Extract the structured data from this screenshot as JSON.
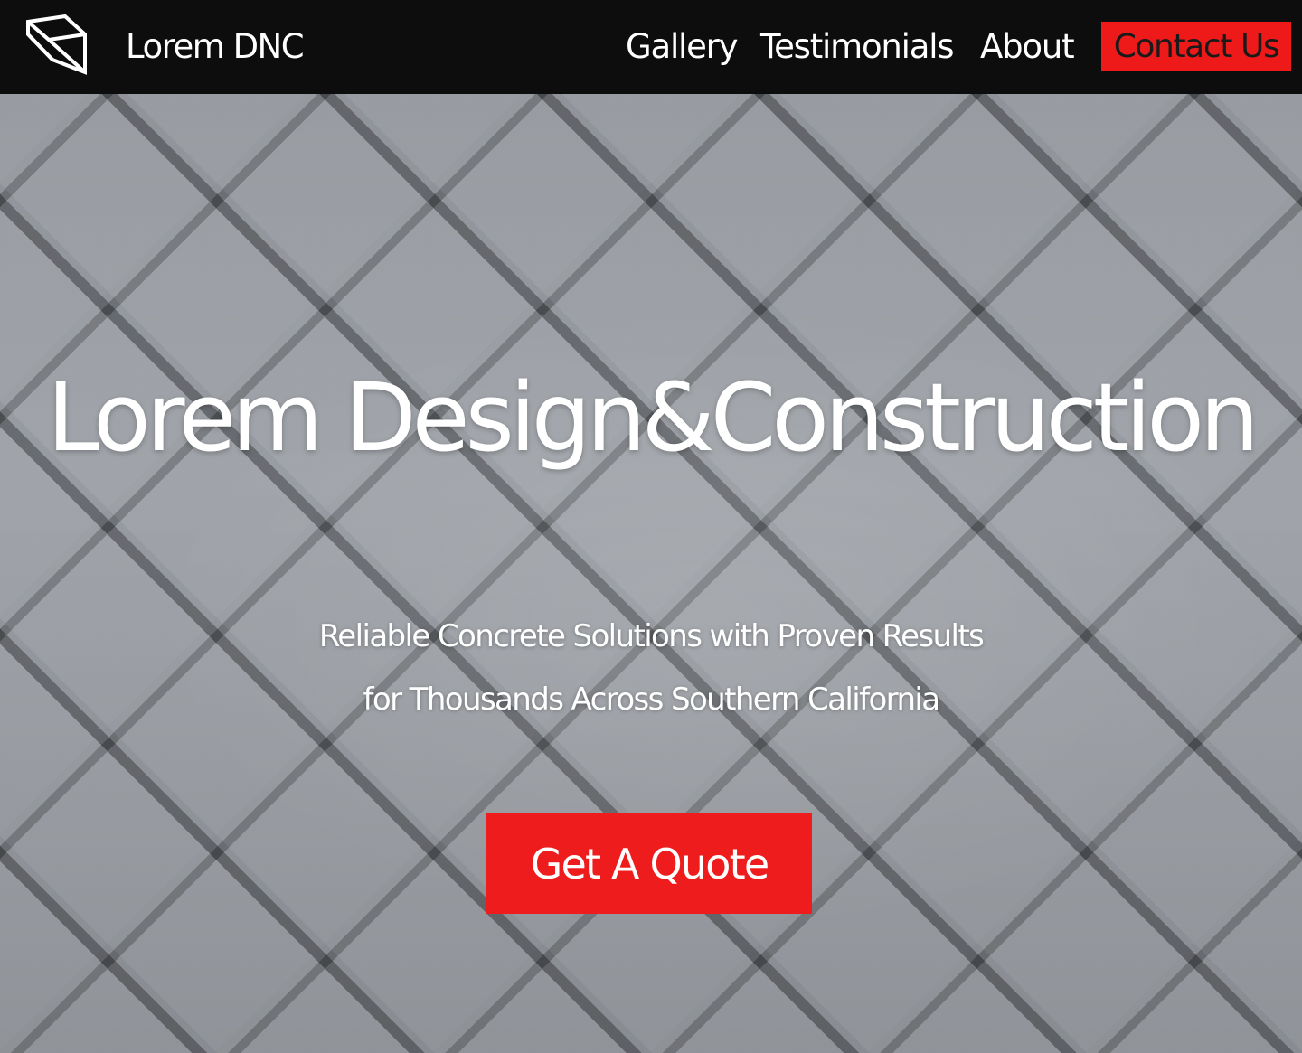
{
  "header": {
    "brand": "Lorem DNC",
    "logo_icon": "box-logo-icon",
    "nav": {
      "gallery": "Gallery",
      "testimonials": "Testimonials",
      "about": "About",
      "contact": "Contact Us"
    }
  },
  "hero": {
    "title": "Lorem Design&Construction",
    "subtitle_line1": "Reliable Concrete Solutions with Proven Results",
    "subtitle_line2": "for Thousands Across Southern California",
    "cta": "Get A Quote"
  },
  "colors": {
    "header_bg": "#0d0d0d",
    "accent_red": "#ee1a1a",
    "text_light": "#ffffff",
    "hero_bg": "#8f949a"
  }
}
